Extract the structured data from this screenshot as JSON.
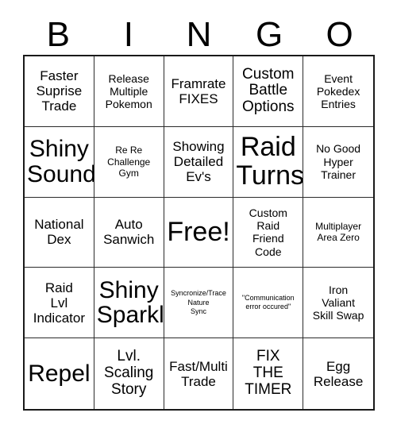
{
  "card": {
    "title": "BINGO",
    "header_letters": [
      "B",
      "I",
      "N",
      "G",
      "O"
    ],
    "columns": 5,
    "rows": 5,
    "free_space_label": "Free!",
    "colors": {
      "background": "#ffffff",
      "text": "#000000",
      "grid_line": "#2b2b2b",
      "outer_border": "#1a1a1a"
    }
  },
  "grid": {
    "row1": [
      {
        "text": "Faster\nSuprise\nTrade",
        "size": "md"
      },
      {
        "text": "Release\nMultiple\nPokemon",
        "size": "sm"
      },
      {
        "text": "Framrate\nFIXES",
        "size": "md"
      },
      {
        "text": "Custom\nBattle\nOptions",
        "size": "lg"
      },
      {
        "text": "Event\nPokedex\nEntries",
        "size": "sm"
      }
    ],
    "row2": [
      {
        "text": "Shiny\nSound",
        "size": "xxl"
      },
      {
        "text": "Re Re\nChallenge\nGym",
        "size": "xs"
      },
      {
        "text": "Showing\nDetailed\nEv's",
        "size": "md"
      },
      {
        "text": "Raid\nTurns",
        "size": "huge"
      },
      {
        "text": "No Good\nHyper\nTrainer",
        "size": "sm"
      }
    ],
    "row3": [
      {
        "text": "National\nDex",
        "size": "md"
      },
      {
        "text": "Auto\nSanwich",
        "size": "md"
      },
      {
        "text": "Free!",
        "size": "huge"
      },
      {
        "text": "Custom\nRaid\nFriend\nCode",
        "size": "sm"
      },
      {
        "text": "Multiplayer\nArea Zero",
        "size": "xs"
      }
    ],
    "row4": [
      {
        "text": "Raid\nLvl\nIndicator",
        "size": "md"
      },
      {
        "text": "Shiny\nSparkle",
        "size": "xxl"
      },
      {
        "text": "Syncronize/Trace\nNature\nSync",
        "size": "xxs"
      },
      {
        "text": "\"Communication\nerror occured\"",
        "size": "xxs"
      },
      {
        "text": "Iron\nValiant\nSkill Swap",
        "size": "sm"
      }
    ],
    "row5": [
      {
        "text": "Repel",
        "size": "xxl"
      },
      {
        "text": "Lvl.\nScaling\nStory",
        "size": "lg"
      },
      {
        "text": "Fast/Multi\nTrade",
        "size": "md"
      },
      {
        "text": "FIX\nTHE\nTIMER",
        "size": "lg"
      },
      {
        "text": "Egg\nRelease",
        "size": "md"
      }
    ]
  }
}
